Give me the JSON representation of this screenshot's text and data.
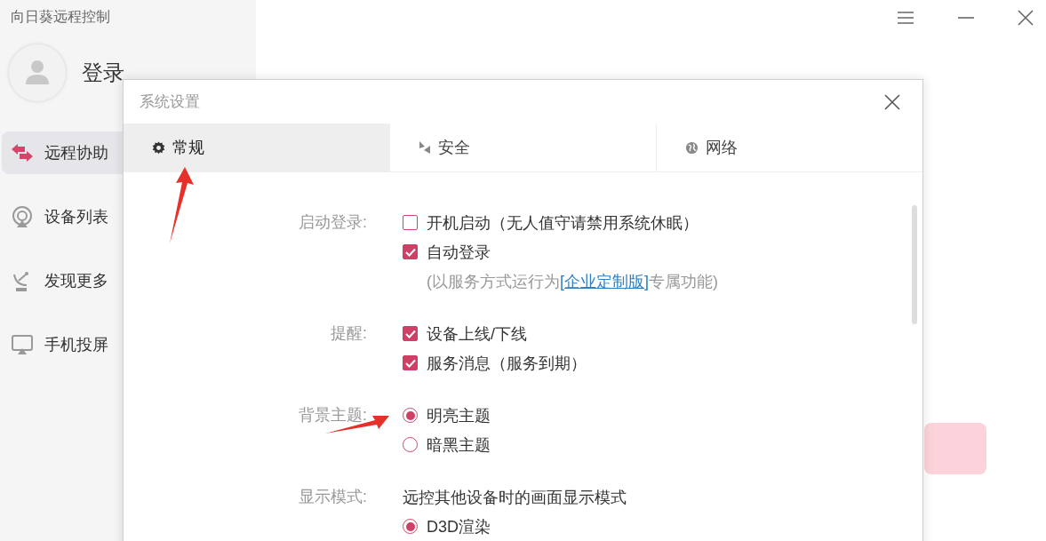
{
  "app": {
    "title": "向日葵远程控制",
    "login": "登录"
  },
  "sidebar": {
    "items": [
      {
        "label": "远程协助",
        "selected": true
      },
      {
        "label": "设备列表",
        "selected": false
      },
      {
        "label": "发现更多",
        "selected": false
      },
      {
        "label": "手机投屏",
        "selected": false
      }
    ]
  },
  "dialog": {
    "title": "系统设置",
    "tabs": [
      {
        "label": "常规",
        "selected": true
      },
      {
        "label": "安全",
        "selected": false
      },
      {
        "label": "网络",
        "selected": false
      }
    ],
    "sections": [
      {
        "label": "启动登录:",
        "items": [
          {
            "kind": "checkbox",
            "text": "开机启动（无人值守请禁用系统休眠）",
            "checked": false
          },
          {
            "kind": "checkbox",
            "text": "自动登录",
            "checked": true
          },
          {
            "kind": "note",
            "text": "(以服务方式运行为",
            "link": "[企业定制版]",
            "after": "专属功能)"
          }
        ]
      },
      {
        "label": "提醒:",
        "items": [
          {
            "kind": "checkbox",
            "text": "设备上线/下线",
            "checked": true
          },
          {
            "kind": "checkbox",
            "text": "服务消息（服务到期）",
            "checked": true
          }
        ]
      },
      {
        "label": "背景主题:",
        "items": [
          {
            "kind": "radio",
            "text": "明亮主题",
            "selected": true
          },
          {
            "kind": "radio",
            "text": "暗黑主题",
            "selected": false
          }
        ]
      },
      {
        "label": "显示模式:",
        "items": [
          {
            "kind": "text",
            "text": "远控其他设备时的画面显示模式"
          },
          {
            "kind": "radio",
            "text": "D3D渲染",
            "selected": true
          }
        ]
      }
    ]
  }
}
